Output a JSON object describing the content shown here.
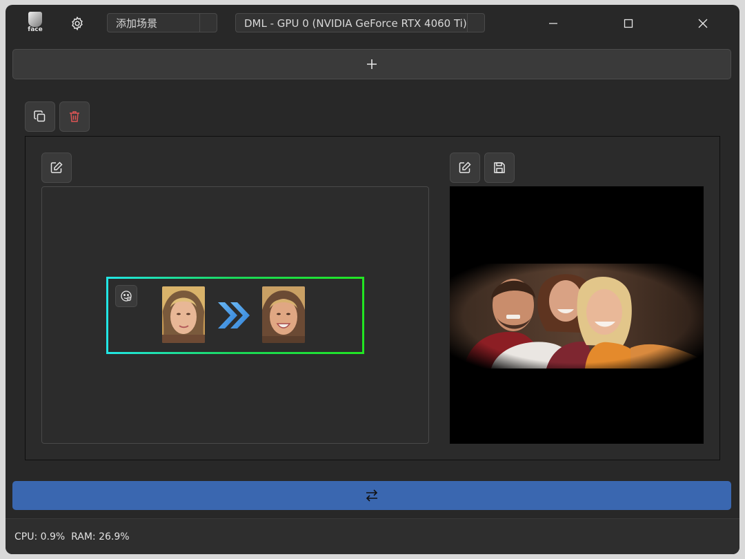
{
  "app": {
    "logo_text": "face"
  },
  "titlebar": {
    "scene_selector_value": "添加场景",
    "device_selector_value": "DML - GPU 0 (NVIDIA GeForce RTX 4060 Ti)"
  },
  "icons": {
    "settings": "gear-icon",
    "minimize": "minimize-icon",
    "maximize": "maximize-icon",
    "close": "close-icon",
    "add_scene": "plus-icon",
    "copy": "copy-icon",
    "delete": "trash-icon",
    "edit_source": "edit-icon",
    "edit_target": "edit-icon",
    "save_result": "save-icon",
    "face_options": "face-icon",
    "mapping_arrow": "double-chevron-right-icon",
    "swap": "swap-arrows-icon"
  },
  "colors": {
    "window_bg": "#282828",
    "swap_bar": "#3a67b0",
    "delete_icon": "#e05555",
    "face_box_gradient_start": "#22e6e6",
    "face_box_gradient_end": "#22e622",
    "arrow_blue": "#4a9ae8"
  },
  "status": {
    "cpu": "CPU: 0.9%",
    "ram": "RAM: 26.9%"
  }
}
